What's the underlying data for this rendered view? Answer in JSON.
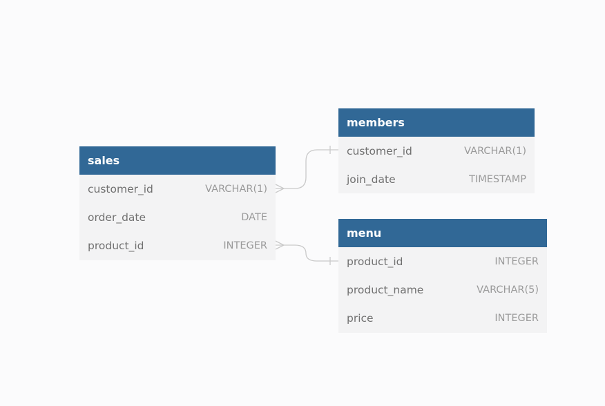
{
  "tables": {
    "sales": {
      "name": "sales",
      "columns": [
        {
          "name": "customer_id",
          "type": "VARCHAR(1)"
        },
        {
          "name": "order_date",
          "type": "DATE"
        },
        {
          "name": "product_id",
          "type": "INTEGER"
        }
      ]
    },
    "members": {
      "name": "members",
      "columns": [
        {
          "name": "customer_id",
          "type": "VARCHAR(1)"
        },
        {
          "name": "join_date",
          "type": "TIMESTAMP"
        }
      ]
    },
    "menu": {
      "name": "menu",
      "columns": [
        {
          "name": "product_id",
          "type": "INTEGER"
        },
        {
          "name": "product_name",
          "type": "VARCHAR(5)"
        },
        {
          "name": "price",
          "type": "INTEGER"
        }
      ]
    }
  },
  "relationships": [
    {
      "from": "sales.customer_id",
      "to": "members.customer_id",
      "from_cardinality": "many",
      "to_cardinality": "one"
    },
    {
      "from": "sales.product_id",
      "to": "menu.product_id",
      "from_cardinality": "many",
      "to_cardinality": "one"
    }
  ],
  "colors": {
    "header_bg": "#316896",
    "header_text": "#ffffff",
    "body_bg": "#f3f3f4",
    "column_name": "#707070",
    "column_type": "#9a9a9a",
    "connector": "#c9c9c9",
    "background": "#fbfbfc"
  }
}
